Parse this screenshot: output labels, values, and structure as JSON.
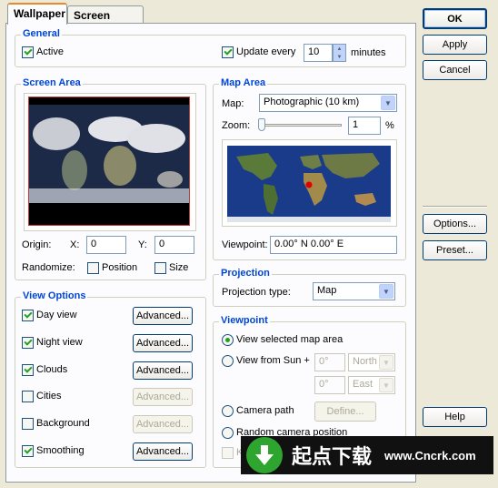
{
  "tabs": [
    {
      "label": "Wallpaper"
    },
    {
      "label": "Screen Saver"
    }
  ],
  "general": {
    "title": "General",
    "active_label": "Active",
    "update_every_label": "Update every",
    "update_every_value": "10",
    "minutes_label": "minutes"
  },
  "screen_area": {
    "title": "Screen Area",
    "origin_label": "Origin:",
    "x_label": "X:",
    "x_value": "0",
    "y_label": "Y:",
    "y_value": "0",
    "randomize_label": "Randomize:",
    "position_label": "Position",
    "size_label": "Size"
  },
  "map_area": {
    "title": "Map Area",
    "map_label": "Map:",
    "map_value": "Photographic (10 km)",
    "zoom_label": "Zoom:",
    "zoom_value": "1",
    "zoom_unit": "%",
    "zoom_fraction": 0.0,
    "viewpoint_label": "Viewpoint:",
    "viewpoint_value": "0.00° N   0.00° E"
  },
  "view_options": {
    "title": "View Options",
    "advanced_label": "Advanced...",
    "items": [
      {
        "label": "Day view",
        "checked": true,
        "advanced_enabled": true
      },
      {
        "label": "Night view",
        "checked": true,
        "advanced_enabled": true
      },
      {
        "label": "Clouds",
        "checked": true,
        "advanced_enabled": true
      },
      {
        "label": "Cities",
        "checked": false,
        "advanced_enabled": false
      },
      {
        "label": "Background",
        "checked": false,
        "advanced_enabled": false
      },
      {
        "label": "Smoothing",
        "checked": true,
        "advanced_enabled": true
      }
    ]
  },
  "projection": {
    "title": "Projection",
    "type_label": "Projection type:",
    "type_value": "Map"
  },
  "viewpoint": {
    "title": "Viewpoint",
    "view_selected_label": "View selected map area",
    "view_from_sun_label": "View from Sun +",
    "sun_lat_value": "0°",
    "sun_lat_dir": "North",
    "sun_lon_value": "0°",
    "sun_lon_dir": "East",
    "camera_path_label": "Camera path",
    "define_label": "Define...",
    "random_camera_label": "Random camera position",
    "partial_label": "K"
  },
  "buttons": {
    "ok": "OK",
    "apply": "Apply",
    "cancel": "Cancel",
    "options": "Options...",
    "preset": "Preset...",
    "help": "Help"
  },
  "watermark": {
    "brand": "起点下载",
    "url": "www.Cncrk.com"
  },
  "colors": {
    "group_title": "#0046d5",
    "check": "#21a121",
    "ocean": "#1a3a8a",
    "marker": "#e00000"
  }
}
